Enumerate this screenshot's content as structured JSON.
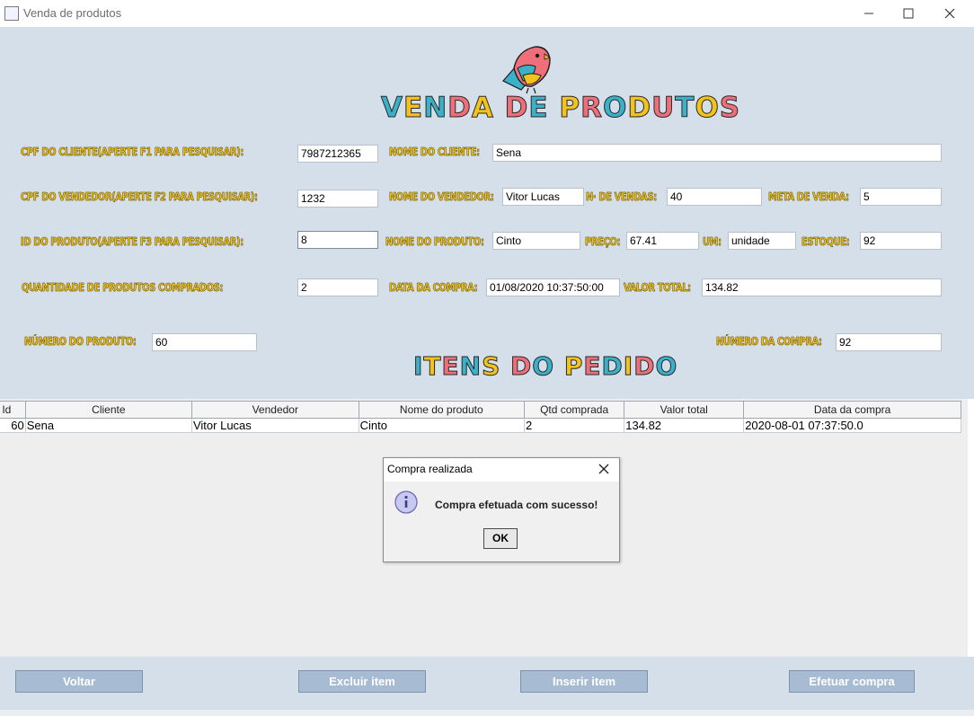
{
  "window": {
    "title": "Venda de produtos"
  },
  "header": {
    "title_letters": [
      "V",
      "E",
      "N",
      "D",
      "A",
      " ",
      "D",
      "E",
      " ",
      "P",
      "R",
      "O",
      "D",
      "U",
      "T",
      "O",
      "S"
    ],
    "title_colors": [
      "#3bb0c9",
      "#f3c21b",
      "#3bb0c9",
      "#ee6f7a",
      "#f3c21b",
      "",
      "#ee6f7a",
      "#3bb0c9",
      "",
      "#f3c21b",
      "#ee6f7a",
      "#3bb0c9",
      "#f3c21b",
      "#ee6f7a",
      "#3bb0c9",
      "#f3c21b",
      "#ee6f7a"
    ]
  },
  "form": {
    "cpf_cliente_label": "CPF DO CLIENTE(APERTE F1 PARA PESQUISAR):",
    "cpf_cliente_value": "7987212365",
    "nome_cliente_label": "NOME DO CLIENTE:",
    "nome_cliente_value": "Sena",
    "cpf_vendedor_label": "CPF DO VENDEDOR(APERTE F2 PARA PESQUISAR):",
    "cpf_vendedor_value": "1232",
    "nome_vendedor_label": "NOME DO VENDEDOR:",
    "nome_vendedor_value": "Vitor Lucas",
    "n_vendas_label": "N· DE VENDAS:",
    "n_vendas_value": "40",
    "meta_venda_label": "META DE VENDA:",
    "meta_venda_value": "5",
    "id_produto_label": "ID DO PRODUTO(APERTE F3 PARA PESQUISAR):",
    "id_produto_value": "8",
    "nome_produto_label": "NOME DO PRODUTO:",
    "nome_produto_value": "Cinto",
    "preco_label": "PREÇO:",
    "preco_value": "67.41",
    "um_label": "UM:",
    "um_value": "unidade",
    "estoque_label": "ESTOQUE:",
    "estoque_value": "92",
    "quantidade_label": "QUANTIDADE DE PRODUTOS COMPRADOS:",
    "quantidade_value": "2",
    "data_compra_label": "DATA DA COMPRA:",
    "data_compra_value": "01/08/2020 10:37:50:00",
    "valor_total_label": "VALOR TOTAL:",
    "valor_total_value": "134.82",
    "numero_produto_label": "NÚMERO DO PRODUTO:",
    "numero_produto_value": "60",
    "numero_compra_label": "NÚMERO DA COMPRA:",
    "numero_compra_value": "92"
  },
  "items": {
    "heading_letters": [
      "I",
      "T",
      "E",
      "N",
      "S",
      " ",
      "D",
      "O",
      " ",
      "P",
      "E",
      "D",
      "I",
      "D",
      "O"
    ],
    "heading_colors": [
      "#3bb0c9",
      "#f3c21b",
      "#ee6f7a",
      "#3bb0c9",
      "#f3c21b",
      "",
      "#ee6f7a",
      "#3bb0c9",
      "",
      "#f3c21b",
      "#ee6f7a",
      "#3bb0c9",
      "#f3c21b",
      "#ee6f7a",
      "#3bb0c9"
    ]
  },
  "table": {
    "columns": [
      "Id",
      "Cliente",
      "Vendedor",
      "Nome do produto",
      "Qtd comprada",
      "Valor total",
      "Data da compra"
    ],
    "rows": [
      [
        "60",
        "Sena",
        "Vitor Lucas",
        "Cinto",
        "2",
        "134.82",
        "2020-08-01 07:37:50.0"
      ]
    ]
  },
  "buttons": {
    "voltar": "Voltar",
    "excluir": "Excluir item",
    "inserir": "Inserir item",
    "efetuar": "Efetuar compra"
  },
  "dialog": {
    "title": "Compra realizada",
    "message": "Compra efetuada com sucesso!",
    "ok": "OK"
  },
  "colors": {
    "panel_bg": "#d4dfea",
    "label_yellow": "#f3c21b",
    "button_bg": "#a7bcd3"
  }
}
